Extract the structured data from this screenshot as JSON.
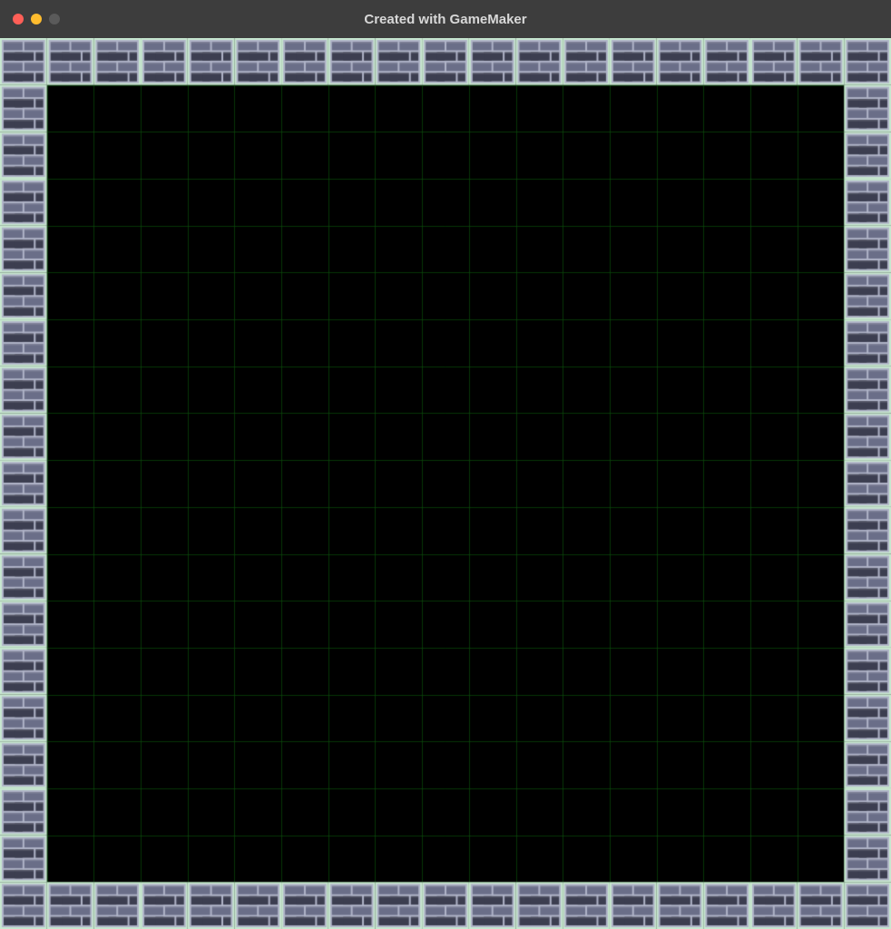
{
  "window": {
    "title": "Created with GameMaker"
  },
  "room": {
    "cols": 19,
    "rows": 19,
    "tile_size": 32,
    "grid_color": "#0a4d0a",
    "floor_color": "#000000",
    "wall_outline": "#c8e8d0",
    "wall_mortar": "#b0b4c8",
    "wall_brick_light": "#6a6e88",
    "wall_brick_dark": "#3c3e50"
  }
}
